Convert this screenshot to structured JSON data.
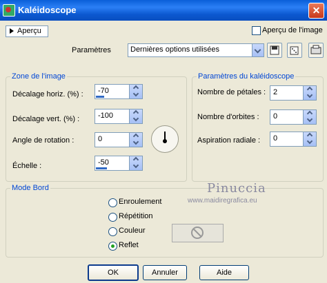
{
  "window": {
    "title": "Kaléidoscope",
    "close_glyph": "✕"
  },
  "top": {
    "preview_toggle_label": "Aperçu",
    "image_preview_label": "Aperçu de l'image",
    "image_preview_checked": false,
    "params_label": "Paramètres",
    "preset_value": "Dernières options utilisées"
  },
  "image_zone": {
    "legend": "Zone de l'image",
    "fields": [
      {
        "label": "Décalage horiz. (%) :",
        "value": "-70"
      },
      {
        "label": "Décalage vert. (%) :",
        "value": "-100"
      },
      {
        "label": "Angle de rotation :",
        "value": "0"
      },
      {
        "label": "Échelle :",
        "value": "-50"
      }
    ]
  },
  "kaleido": {
    "legend": "Paramètres du kaléidoscope",
    "fields": [
      {
        "label": "Nombre de pétales :",
        "value": "2"
      },
      {
        "label": "Nombre d'orbites :",
        "value": "0"
      },
      {
        "label": "Aspiration radiale :",
        "value": "0"
      }
    ]
  },
  "edge_mode": {
    "legend": "Mode Bord",
    "options": [
      "Enroulement",
      "Répétition",
      "Couleur",
      "Reflet"
    ],
    "selected": "Reflet"
  },
  "watermark": {
    "name": "Pinuccia",
    "url": "www.maidiregrafica.eu"
  },
  "buttons": {
    "ok": "OK",
    "cancel": "Annuler",
    "help": "Aide"
  }
}
